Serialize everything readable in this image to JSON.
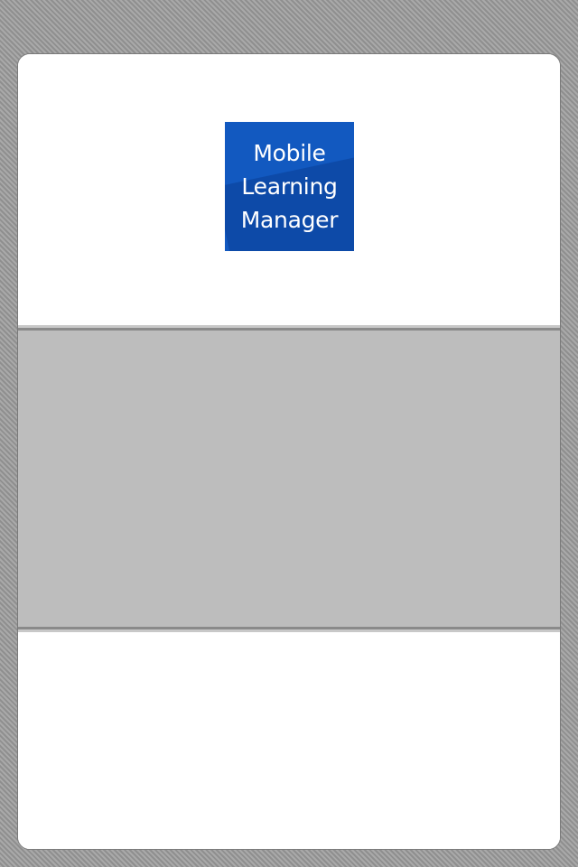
{
  "app": {
    "logo_text": "Mobile\nLearning\nManager"
  },
  "colors": {
    "logo_blue": "#1259c0",
    "panel_gray": "#bdbdbd",
    "card_white": "#ffffff"
  }
}
